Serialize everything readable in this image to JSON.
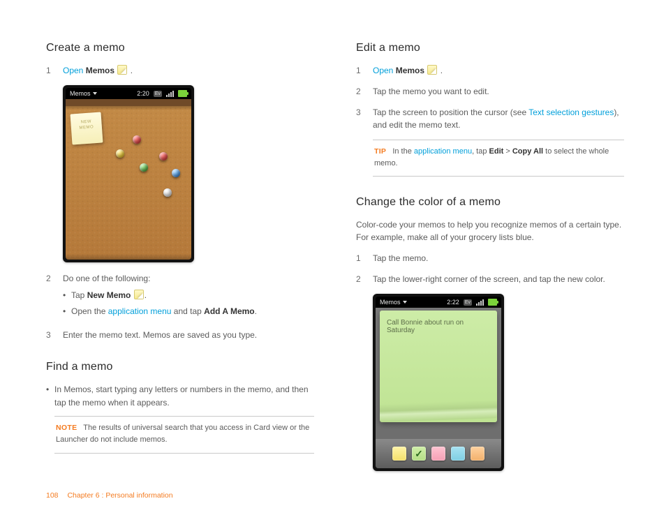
{
  "left": {
    "create": {
      "heading": "Create a memo",
      "step1_link": "Open",
      "step1_app": "Memos",
      "step1_dot": ".",
      "screenshot": {
        "app_label": "Memos",
        "time": "2:20",
        "ev": "Ev",
        "sticky_line1": "NEW",
        "sticky_line2": "MEMO"
      },
      "step2_intro": "Do one of the following:",
      "step2_a_pre": "Tap ",
      "step2_a_b": "New Memo",
      "step2_a_post": " ",
      "step2_a_dot": ".",
      "step2_b_pre": "Open the ",
      "step2_b_link": "application menu",
      "step2_b_mid": " and tap ",
      "step2_b_b": "Add A Memo",
      "step2_b_dot": ".",
      "step3": "Enter the memo text. Memos are saved as you type."
    },
    "find": {
      "heading": "Find a memo",
      "bullet": "In Memos, start typing any letters or numbers in the memo, and then tap the memo when it appears.",
      "note_tag": "NOTE",
      "note_text": "The results of universal search that you access in Card view or the Launcher do not include memos."
    }
  },
  "right": {
    "edit": {
      "heading": "Edit a memo",
      "s1_link": "Open",
      "s1_app": "Memos",
      "s1_dot": ".",
      "s2": "Tap the memo you want to edit.",
      "s3_pre": "Tap the screen to position the cursor (see ",
      "s3_link": "Text selection gestures",
      "s3_post": "), and edit the memo text.",
      "tip_tag": "TIP",
      "tip_pre": "In the ",
      "tip_link": "application menu",
      "tip_mid": ", tap ",
      "tip_b1": "Edit",
      "tip_gt": " > ",
      "tip_b2": "Copy All",
      "tip_post": " to select the whole memo."
    },
    "color": {
      "heading": "Change the color of a memo",
      "intro": "Color-code your memos to help you recognize memos of a certain type. For example, make all of your grocery lists blue.",
      "s1": "Tap the memo.",
      "s2": "Tap the lower-right corner of the screen, and tap the new color.",
      "screenshot": {
        "app_label": "Memos",
        "time": "2:22",
        "ev": "Ev",
        "memo_text": "Call Bonnie about run on Saturday"
      }
    }
  },
  "footer": {
    "page": "108",
    "chapter": "Chapter 6 : Personal information"
  }
}
